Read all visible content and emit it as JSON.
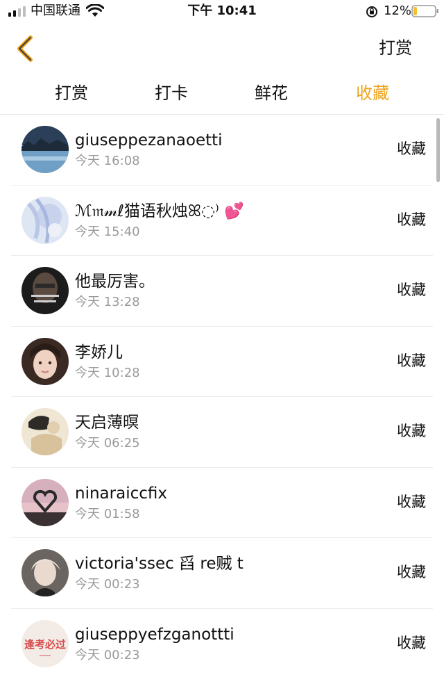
{
  "status_bar": {
    "carrier": "中国联通",
    "time": "下午 10:41",
    "battery_percent": "12%",
    "battery_level": 0.12
  },
  "nav": {
    "back_icon": "chevron-left-icon",
    "accent_color": "#F0A21A",
    "action_label": "打赏"
  },
  "tabs": [
    {
      "label": "打赏",
      "active": false
    },
    {
      "label": "打卡",
      "active": false
    },
    {
      "label": "鲜花",
      "active": false
    },
    {
      "label": "收藏",
      "active": true
    }
  ],
  "list": [
    {
      "name": "giuseppezanaoetti",
      "time": "今天 16:08",
      "action": "收藏"
    },
    {
      "name": "ℳ𝔪𝓂ℓ猫语秋烛ꕤ◌⁾ 💕",
      "time": "今天 15:40",
      "action": "收藏"
    },
    {
      "name": "他最厉害。",
      "time": "今天 13:28",
      "action": "收藏"
    },
    {
      "name": "李娇儿",
      "time": "今天 10:28",
      "action": "收藏"
    },
    {
      "name": "天启薄暝",
      "time": "今天 06:25",
      "action": "收藏"
    },
    {
      "name": "ninaraiccfix",
      "time": "今天 01:58",
      "action": "收藏"
    },
    {
      "name": "victoria'ssec 舀 re贼 t",
      "time": "今天 00:23",
      "action": "收藏"
    },
    {
      "name": "giuseppyefzganottti",
      "time": "今天 00:23",
      "action": "收藏",
      "avatar_text": "逢考必过"
    }
  ]
}
